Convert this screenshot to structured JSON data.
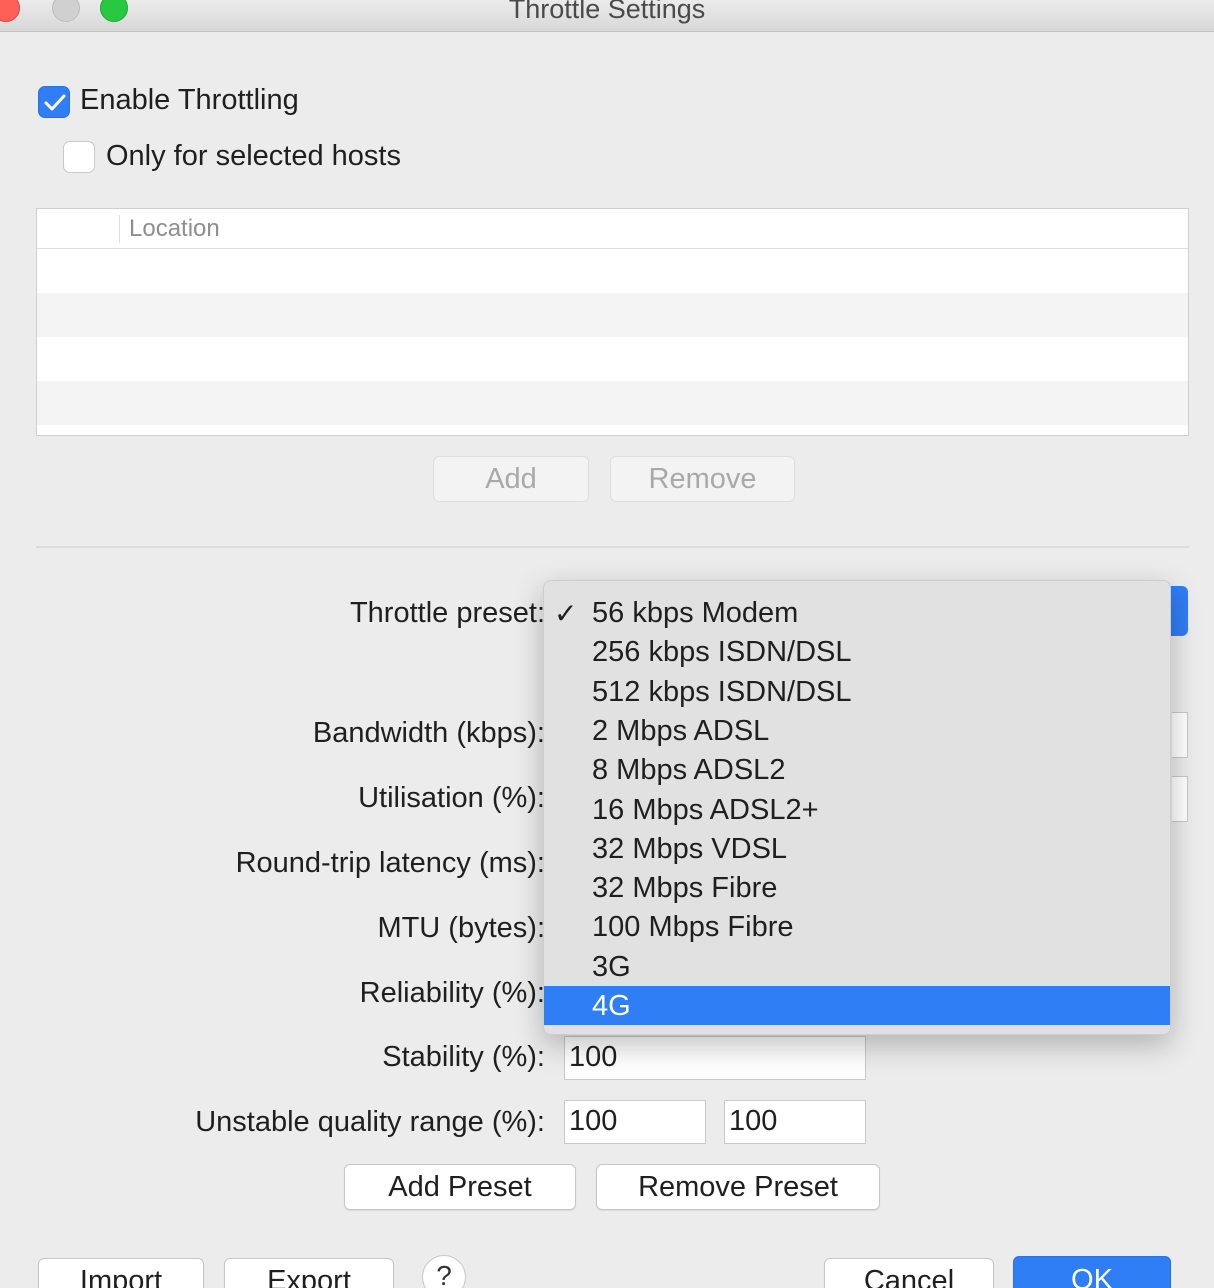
{
  "window": {
    "title": "Throttle Settings"
  },
  "enable_throttling": {
    "label": "Enable Throttling",
    "checked": true
  },
  "only_selected_hosts": {
    "label": "Only for selected hosts",
    "checked": false
  },
  "hosts_table": {
    "column": "Location"
  },
  "host_buttons": {
    "add": "Add",
    "remove": "Remove"
  },
  "form": {
    "preset_label": "Throttle preset:",
    "bandwidth_label": "Bandwidth (kbps):",
    "utilisation_label": "Utilisation (%):",
    "latency_label": "Round-trip latency (ms):",
    "mtu_label": "MTU (bytes):",
    "reliability_label": "Reliability (%):",
    "stability_label": "Stability (%):",
    "stability_value": "100",
    "unstable_label": "Unstable quality range (%):",
    "unstable_min": "100",
    "unstable_max": "100"
  },
  "preset_buttons": {
    "add": "Add Preset",
    "remove": "Remove Preset"
  },
  "preset_menu": {
    "checkmark": "✓",
    "options": [
      "56 kbps Modem",
      "256 kbps ISDN/DSL",
      "512 kbps ISDN/DSL",
      "2 Mbps ADSL",
      "8 Mbps ADSL2",
      "16 Mbps ADSL2+",
      "32 Mbps VDSL",
      "32 Mbps Fibre",
      "100 Mbps Fibre",
      "3G",
      "4G"
    ],
    "checked_option": "56 kbps Modem",
    "highlighted_option": "4G"
  },
  "footer": {
    "import": "Import",
    "export": "Export",
    "help": "?",
    "cancel": "Cancel",
    "ok": "OK"
  },
  "colors": {
    "accent": "#2f7ef6",
    "close": "#fe5f57",
    "zoom": "#28c840"
  }
}
